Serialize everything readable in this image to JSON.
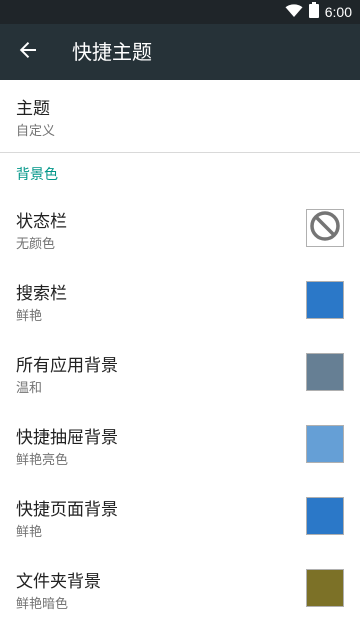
{
  "status_bar": {
    "time": "6:00",
    "icons": [
      "wifi-icon",
      "battery-icon"
    ]
  },
  "app_bar": {
    "back_icon": "arrow-back-icon",
    "title": "快捷主题"
  },
  "theme_pref": {
    "title": "主题",
    "summary": "自定义"
  },
  "section": {
    "title": "背景色"
  },
  "color_prefs": [
    {
      "title": "状态栏",
      "summary": "无颜色",
      "color": "none",
      "icon": "no-color-icon"
    },
    {
      "title": "搜索栏",
      "summary": "鲜艳",
      "color": "#2b78c8"
    },
    {
      "title": "所有应用背景",
      "summary": "温和",
      "color": "#667f94"
    },
    {
      "title": "快捷抽屉背景",
      "summary": "鲜艳亮色",
      "color": "#659fd6"
    },
    {
      "title": "快捷页面背景",
      "summary": "鲜艳",
      "color": "#2b78c8"
    },
    {
      "title": "文件夹背景",
      "summary": "鲜艳暗色",
      "color": "#7c7127"
    }
  ],
  "colors": {
    "status_bar_bg": "#1f2529",
    "app_bar_bg": "#263238",
    "accent": "#009688"
  }
}
